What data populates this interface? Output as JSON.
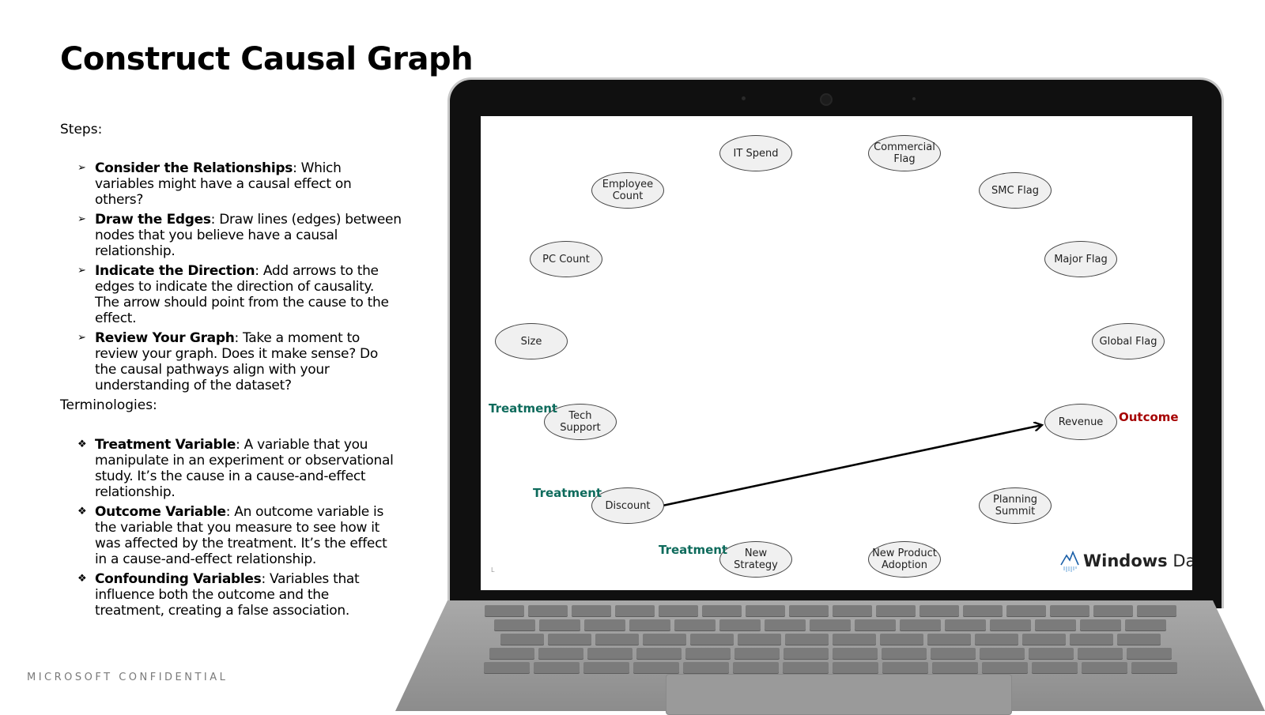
{
  "slide": {
    "title": "Construct Causal Graph",
    "steps_label": "Steps:",
    "steps": [
      {
        "term": "Consider the Relationships",
        "text": ": Which variables might have a causal effect on others?"
      },
      {
        "term": "Draw the Edges",
        "text": ": Draw lines (edges) between nodes that you believe have a causal relationship."
      },
      {
        "term": "Indicate the Direction",
        "text": ": Add arrows to the edges to indicate the direction of causality. The arrow should point from the cause to the effect."
      },
      {
        "term": "Review Your Graph",
        "text": ": Take a moment to review your graph. Does it make sense? Do the causal pathways align with your understanding of the dataset?"
      }
    ],
    "terms_label": "Terminologies:",
    "terms": [
      {
        "term": "Treatment Variable",
        "text": ": A variable that you manipulate in an experiment or observational study. It’s the cause in a cause-and-effect relationship."
      },
      {
        "term": "Outcome Variable",
        "text": ": An outcome variable is the variable that you measure to see how it was affected by the treatment. It’s the effect in a cause-and-effect relationship."
      },
      {
        "term": "Confounding Variables",
        "text": ": Variables that influence both the outcome and the treatment, creating a false association."
      }
    ],
    "step_bullet": "➢",
    "term_bullet": "❖",
    "footer": "MICROSOFT CONFIDENTIAL"
  },
  "diagram": {
    "nodes": {
      "it_spend": "IT Spend",
      "commercial_flag": [
        "Commercial",
        "Flag"
      ],
      "employee_count": [
        "Employee",
        "Count"
      ],
      "smc_flag": "SMC Flag",
      "pc_count": "PC Count",
      "major_flag": "Major Flag",
      "size": "Size",
      "global_flag": "Global Flag",
      "tech_support": [
        "Tech",
        "Support"
      ],
      "revenue": "Revenue",
      "discount": "Discount",
      "planning_summit": [
        "Planning",
        "Summit"
      ],
      "new_strategy": [
        "New",
        "Strategy"
      ],
      "new_product_adoption": [
        "New Product",
        "Adoption"
      ]
    },
    "treatment_label": "Treatment",
    "outcome_label": "Outcome",
    "edges": [
      {
        "from": "Discount",
        "to": "Revenue"
      }
    ],
    "corner_mark": "L",
    "brand": {
      "bold": "Windows",
      "rest": " Data"
    },
    "colors": {
      "treatment": "#0e6b5c",
      "outcome": "#a50000",
      "edge": "#000000"
    }
  }
}
